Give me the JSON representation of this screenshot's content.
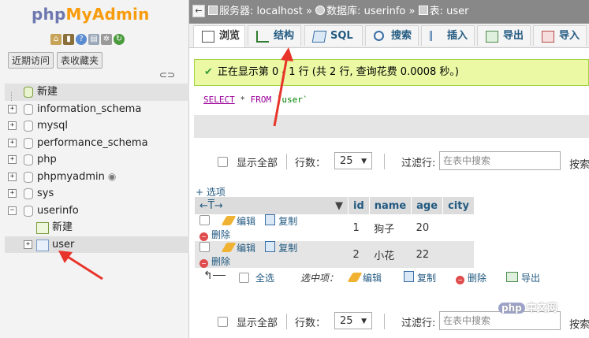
{
  "logo": {
    "part1": "php",
    "part2": "MyAdmin"
  },
  "nav": {
    "tabs": [
      "近期访问",
      "表收藏夹"
    ],
    "tree": [
      {
        "label": "新建",
        "kind": "new"
      },
      {
        "label": "information_schema",
        "kind": "db"
      },
      {
        "label": "mysql",
        "kind": "db"
      },
      {
        "label": "performance_schema",
        "kind": "db"
      },
      {
        "label": "php",
        "kind": "db"
      },
      {
        "label": "phpmyadmin",
        "kind": "db"
      },
      {
        "label": "sys",
        "kind": "db"
      },
      {
        "label": "userinfo",
        "kind": "db-open"
      },
      {
        "label": "新建",
        "kind": "child-new"
      },
      {
        "label": "user",
        "kind": "child-table"
      }
    ]
  },
  "breadcrumb": {
    "server": "服务器: localhost",
    "database": "数据库: userinfo",
    "table": "表: user",
    "sep": "»"
  },
  "tabs": [
    {
      "label": "浏览",
      "active": true
    },
    {
      "label": "结构",
      "active": false
    },
    {
      "label": "SQL",
      "active": false
    },
    {
      "label": "搜索",
      "active": false
    },
    {
      "label": "插入",
      "active": false
    },
    {
      "label": "导出",
      "active": false
    },
    {
      "label": "导入",
      "active": false
    }
  ],
  "message": "正在显示第 0 - 1 行 (共 2 行, 查询花费 0.0008 秒。)",
  "sql": {
    "kw1": "SELECT",
    "star": "*",
    "kw2": "FROM",
    "table": "`user`"
  },
  "controls": {
    "show_all": "显示全部",
    "rows_label": "行数：",
    "rows_value": "25",
    "filter_label": "过滤行:",
    "filter_placeholder": "在表中搜索",
    "sort_label": "按索"
  },
  "options_link": "+ 选项",
  "table": {
    "columns": [
      "id",
      "name",
      "age",
      "city"
    ],
    "rows": [
      {
        "id": "1",
        "name": "狗子",
        "age": "20",
        "city": ""
      },
      {
        "id": "2",
        "name": "小花",
        "age": "22",
        "city": ""
      }
    ],
    "actions": {
      "edit": "编辑",
      "copy": "复制",
      "delete": "删除"
    }
  },
  "bulk": {
    "check_all": "全选",
    "with_selected": "选中项：",
    "edit": "编辑",
    "copy": "复制",
    "delete": "删除",
    "export": "导出"
  },
  "watermark": {
    "badge": "php",
    "text": "中文网"
  }
}
